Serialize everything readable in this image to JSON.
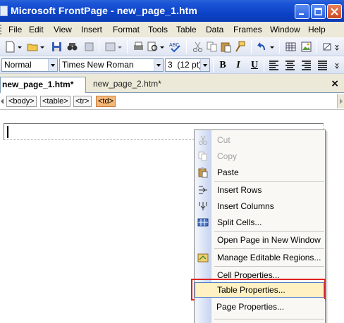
{
  "window": {
    "title": "Microsoft FrontPage - new_page_1.htm"
  },
  "menu": {
    "items": [
      "File",
      "Edit",
      "View",
      "Insert",
      "Format",
      "Tools",
      "Table",
      "Data",
      "Frames",
      "Window",
      "Help"
    ]
  },
  "format_toolbar": {
    "style_value": "Normal",
    "font_value": "Times New Roman",
    "size_value": "3  (12 pt)",
    "bold_label": "B",
    "italic_label": "I",
    "underline_label": "U"
  },
  "tabs": {
    "active_label": "new_page_1.htm*",
    "inactive_label": "new_page_2.htm*",
    "close_label": "×"
  },
  "tag_selector": {
    "tags": [
      "<body>",
      "<table>",
      "<tr>",
      "<td>"
    ],
    "selected_tag": "<td>"
  },
  "context_menu": {
    "items": [
      {
        "label": "Cut",
        "icon": "scissors-icon",
        "enabled": false
      },
      {
        "label": "Copy",
        "icon": "copy-icon",
        "enabled": false
      },
      {
        "label": "Paste",
        "icon": "paste-icon",
        "enabled": true
      },
      {
        "label": "Insert Rows",
        "icon": "insert-rows-icon",
        "enabled": true
      },
      {
        "label": "Insert Columns",
        "icon": "insert-columns-icon",
        "enabled": true
      },
      {
        "label": "Split Cells...",
        "icon": "split-cells-icon",
        "enabled": true
      },
      {
        "label": "Open Page in New Window",
        "icon": "",
        "enabled": true
      },
      {
        "label": "Manage Editable Regions...",
        "icon": "editable-regions-icon",
        "enabled": true
      },
      {
        "label": "Cell Properties...",
        "icon": "",
        "enabled": true
      },
      {
        "label": "Table Properties...",
        "icon": "",
        "enabled": true,
        "highlighted": true
      },
      {
        "label": "Page Properties...",
        "icon": "",
        "enabled": true
      }
    ]
  },
  "colors": {
    "titlebar": "#0d43c8",
    "highlight_outline": "#e02020",
    "selected_tag": "#f4b878",
    "menu_hover": "#fff1c2"
  }
}
